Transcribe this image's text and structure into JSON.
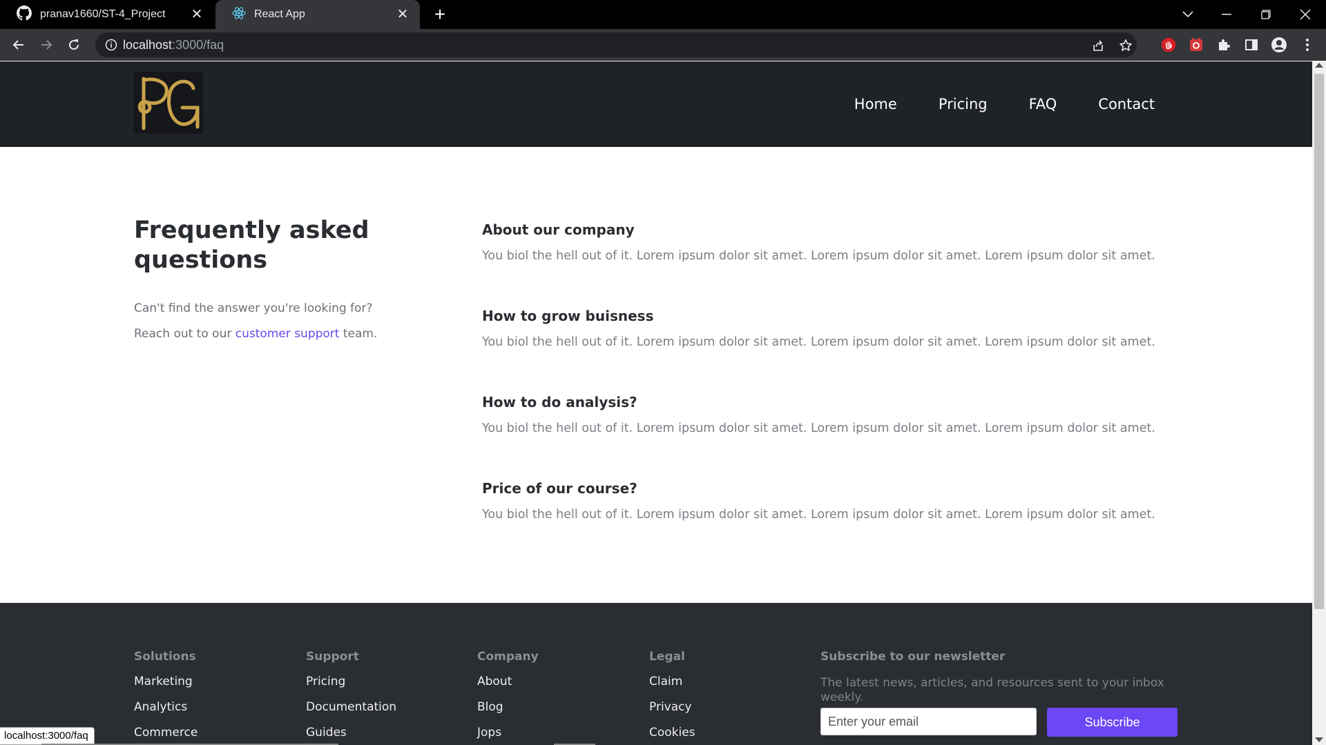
{
  "browser": {
    "tabs": [
      {
        "title": "pranav1660/ST-4_Project",
        "icon": "github-icon",
        "active": false
      },
      {
        "title": "React App",
        "icon": "react-icon",
        "active": true
      }
    ],
    "url_host": "localhost",
    "url_path": ":3000/faq",
    "status_url": "localhost:3000/faq"
  },
  "site": {
    "logo_text": "PG",
    "nav": [
      "Home",
      "Pricing",
      "FAQ",
      "Contact"
    ],
    "colors": {
      "header_bg": "#1f2226",
      "accent": "#6c47f5",
      "logo_gold": "#c9a24a",
      "footer_bg": "#2a2d32"
    }
  },
  "faq": {
    "title": "Frequently asked questions",
    "subtitle_line1": "Can't find the answer you're looking for?",
    "subtitle_pre": "Reach out to our ",
    "support_link": "customer support",
    "subtitle_post": " team.",
    "items": [
      {
        "question": "About our company",
        "answer": "You biol the hell out of it. Lorem ipsum dolor sit amet. Lorem ipsum dolor sit amet. Lorem ipsum dolor sit amet."
      },
      {
        "question": "How to grow buisness",
        "answer": "You biol the hell out of it. Lorem ipsum dolor sit amet. Lorem ipsum dolor sit amet. Lorem ipsum dolor sit amet."
      },
      {
        "question": "How to do analysis?",
        "answer": "You biol the hell out of it. Lorem ipsum dolor sit amet. Lorem ipsum dolor sit amet. Lorem ipsum dolor sit amet."
      },
      {
        "question": "Price of our course?",
        "answer": "You biol the hell out of it. Lorem ipsum dolor sit amet. Lorem ipsum dolor sit amet. Lorem ipsum dolor sit amet."
      }
    ]
  },
  "footer": {
    "columns": [
      {
        "heading": "Solutions",
        "links": [
          "Marketing",
          "Analytics",
          "Commerce"
        ]
      },
      {
        "heading": "Support",
        "links": [
          "Pricing",
          "Documentation",
          "Guides"
        ]
      },
      {
        "heading": "Company",
        "links": [
          "About",
          "Blog",
          "Jops"
        ]
      },
      {
        "heading": "Legal",
        "links": [
          "Claim",
          "Privacy",
          "Cookies"
        ]
      }
    ],
    "newsletter": {
      "heading": "Subscribe to our newsletter",
      "text": "The latest news, articles, and resources sent to your inbox weekly.",
      "placeholder": "Enter your email",
      "button": "Subscribe"
    }
  }
}
